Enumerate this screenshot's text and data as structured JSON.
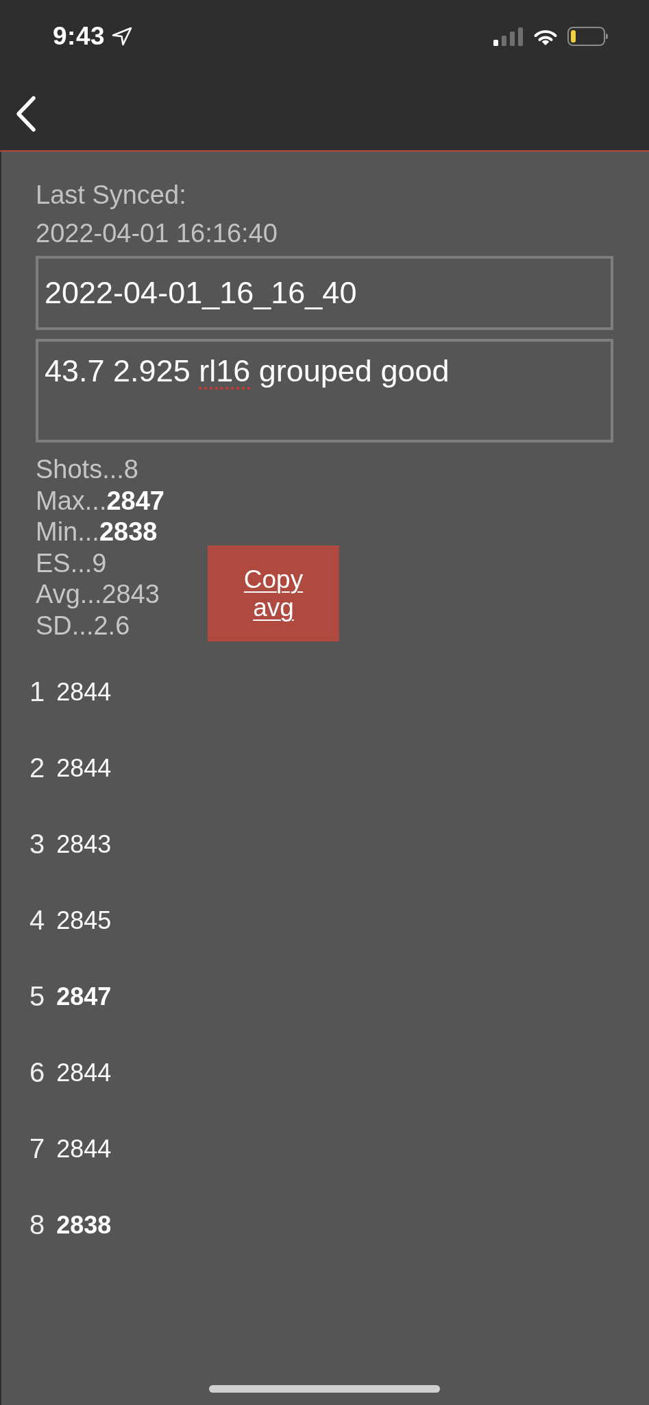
{
  "status_bar": {
    "time": "9:43"
  },
  "sync": {
    "label": "Last Synced:",
    "timestamp": "2022-04-01 16:16:40"
  },
  "name_field": {
    "value": "2022-04-01_16_16_40"
  },
  "notes_field": {
    "segments": [
      {
        "text": "43.7 2.925 ",
        "misspelled": false
      },
      {
        "text": "rl16",
        "misspelled": true
      },
      {
        "text": " grouped good",
        "misspelled": false
      }
    ]
  },
  "stats": [
    "Shots...8",
    "Max...**2847**",
    "Min...**2838**",
    "ES...9",
    "Avg...2843",
    "SD...2.6"
  ],
  "copy_button": {
    "label": "Copy avg"
  },
  "shots": [
    {
      "number": "1",
      "velocity": "2844",
      "highlighted": false
    },
    {
      "number": "2",
      "velocity": "2844",
      "highlighted": false
    },
    {
      "number": "3",
      "velocity": "2843",
      "highlighted": false
    },
    {
      "number": "4",
      "velocity": "2845",
      "highlighted": false
    },
    {
      "number": "5",
      "velocity": "2847",
      "highlighted": true
    },
    {
      "number": "6",
      "velocity": "2844",
      "highlighted": false
    },
    {
      "number": "7",
      "velocity": "2844",
      "highlighted": false
    },
    {
      "number": "8",
      "velocity": "2838",
      "highlighted": true
    }
  ]
}
